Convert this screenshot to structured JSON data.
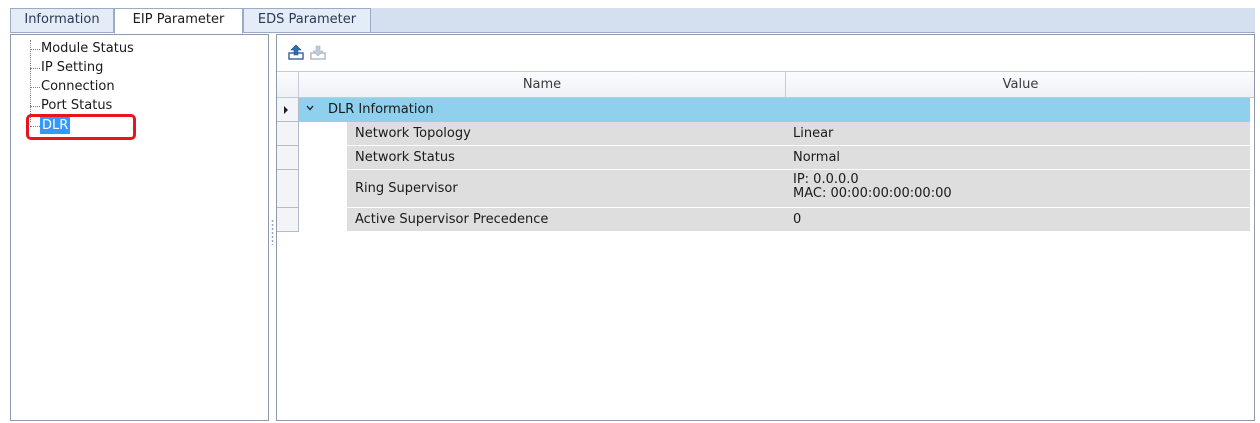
{
  "tabs": [
    {
      "label": "Information"
    },
    {
      "label": "EIP Parameter"
    },
    {
      "label": "EDS Parameter"
    }
  ],
  "tree": {
    "items": [
      {
        "label": "Module Status"
      },
      {
        "label": "IP Setting"
      },
      {
        "label": "Connection"
      },
      {
        "label": "Port Status"
      },
      {
        "label": "DLR"
      }
    ],
    "selected": "DLR"
  },
  "toolbar": {
    "upload_icon": "upload-icon",
    "download_icon": "download-icon"
  },
  "grid": {
    "columns": {
      "name": "Name",
      "value": "Value"
    },
    "group": {
      "label": "DLR Information"
    },
    "rows": [
      {
        "name": "Network Topology",
        "value": "Linear"
      },
      {
        "name": "Network Status",
        "value": "Normal"
      },
      {
        "name": "Ring Supervisor",
        "value_ip": "IP: 0.0.0.0",
        "value_mac": "MAC: 00:00:00:00:00:00"
      },
      {
        "name": "Active Supervisor Precedence",
        "value": "0"
      }
    ]
  },
  "colors": {
    "group_row": "#8fd0ee",
    "data_row": "#dedede",
    "selection": "#3399ff",
    "highlight": "#e8141e"
  }
}
